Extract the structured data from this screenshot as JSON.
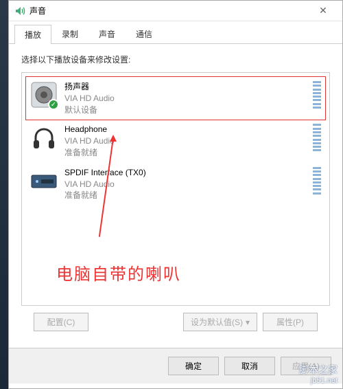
{
  "window": {
    "title": "声音"
  },
  "tabs": {
    "t0": "播放",
    "t1": "录制",
    "t2": "声音",
    "t3": "通信"
  },
  "instruction": "选择以下播放设备来修改设置:",
  "devices": [
    {
      "name": "扬声器",
      "sub": "VIA HD Audio",
      "status": "默认设备",
      "default": true
    },
    {
      "name": "Headphone",
      "sub": "VIA HD Audio",
      "status": "准备就绪",
      "default": false
    },
    {
      "name": "SPDIF Interface (TX0)",
      "sub": "VIA HD Audio",
      "status": "准备就绪",
      "default": false
    }
  ],
  "annotation": "电脑自带的喇叭",
  "buttons": {
    "configure": "配置(C)",
    "setdefault": "设为默认值(S)",
    "properties": "属性(P)",
    "ok": "确定",
    "cancel": "取消",
    "apply": "应用(A)"
  },
  "watermark": {
    "cn": "脚本之家",
    "url": "jb51.net"
  }
}
